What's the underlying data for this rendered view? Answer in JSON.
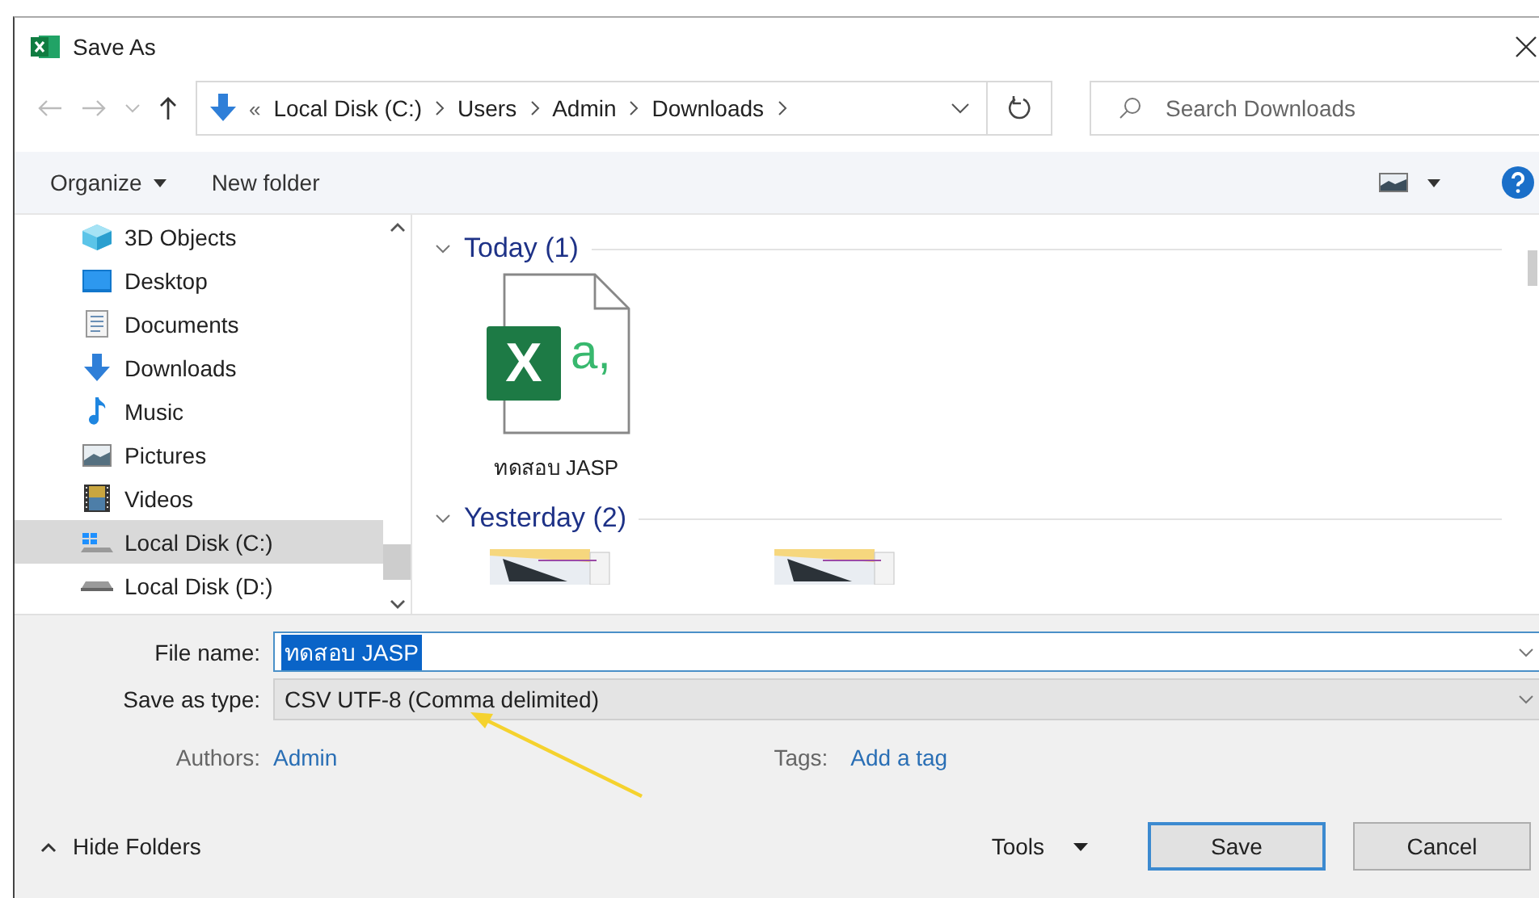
{
  "window": {
    "title": "Save As"
  },
  "nav": {
    "overflow": "«",
    "path": [
      "Local Disk (C:)",
      "Users",
      "Admin",
      "Downloads"
    ]
  },
  "search": {
    "placeholder": "Search Downloads"
  },
  "toolbar": {
    "organize": "Organize",
    "new_folder": "New folder"
  },
  "sidebar": {
    "items": [
      {
        "label": "3D Objects",
        "kind": "objects",
        "selected": false
      },
      {
        "label": "Desktop",
        "kind": "desktop",
        "selected": false
      },
      {
        "label": "Documents",
        "kind": "documents",
        "selected": false
      },
      {
        "label": "Downloads",
        "kind": "downloads",
        "selected": false
      },
      {
        "label": "Music",
        "kind": "music",
        "selected": false
      },
      {
        "label": "Pictures",
        "kind": "pictures",
        "selected": false
      },
      {
        "label": "Videos",
        "kind": "videos",
        "selected": false
      },
      {
        "label": "Local Disk (C:)",
        "kind": "system-disk",
        "selected": true
      },
      {
        "label": "Local Disk (D:)",
        "kind": "disk",
        "selected": false
      }
    ]
  },
  "groups": [
    {
      "label": "Today (1)",
      "expanded": true,
      "files": [
        {
          "kind": "csv",
          "name": "ทดสอบ JASP",
          "icon_letter": "X",
          "icon_mark": "a,"
        }
      ]
    },
    {
      "label": "Yesterday (2)",
      "expanded": true
    }
  ],
  "form": {
    "file_name_label": "File name:",
    "file_name": "ทดสอบ JASP",
    "file_name_selected": true,
    "type_label": "Save as type:",
    "type": "CSV UTF-8 (Comma delimited)",
    "authors_label": "Authors:",
    "authors": "Admin",
    "tags_label": "Tags:",
    "tags": "Add a tag"
  },
  "footer": {
    "hide_folders": "Hide Folders",
    "tools": "Tools",
    "buttons": [
      {
        "label": "Save",
        "kind": "primary"
      },
      {
        "label": "Cancel",
        "kind": "secondary"
      }
    ]
  }
}
